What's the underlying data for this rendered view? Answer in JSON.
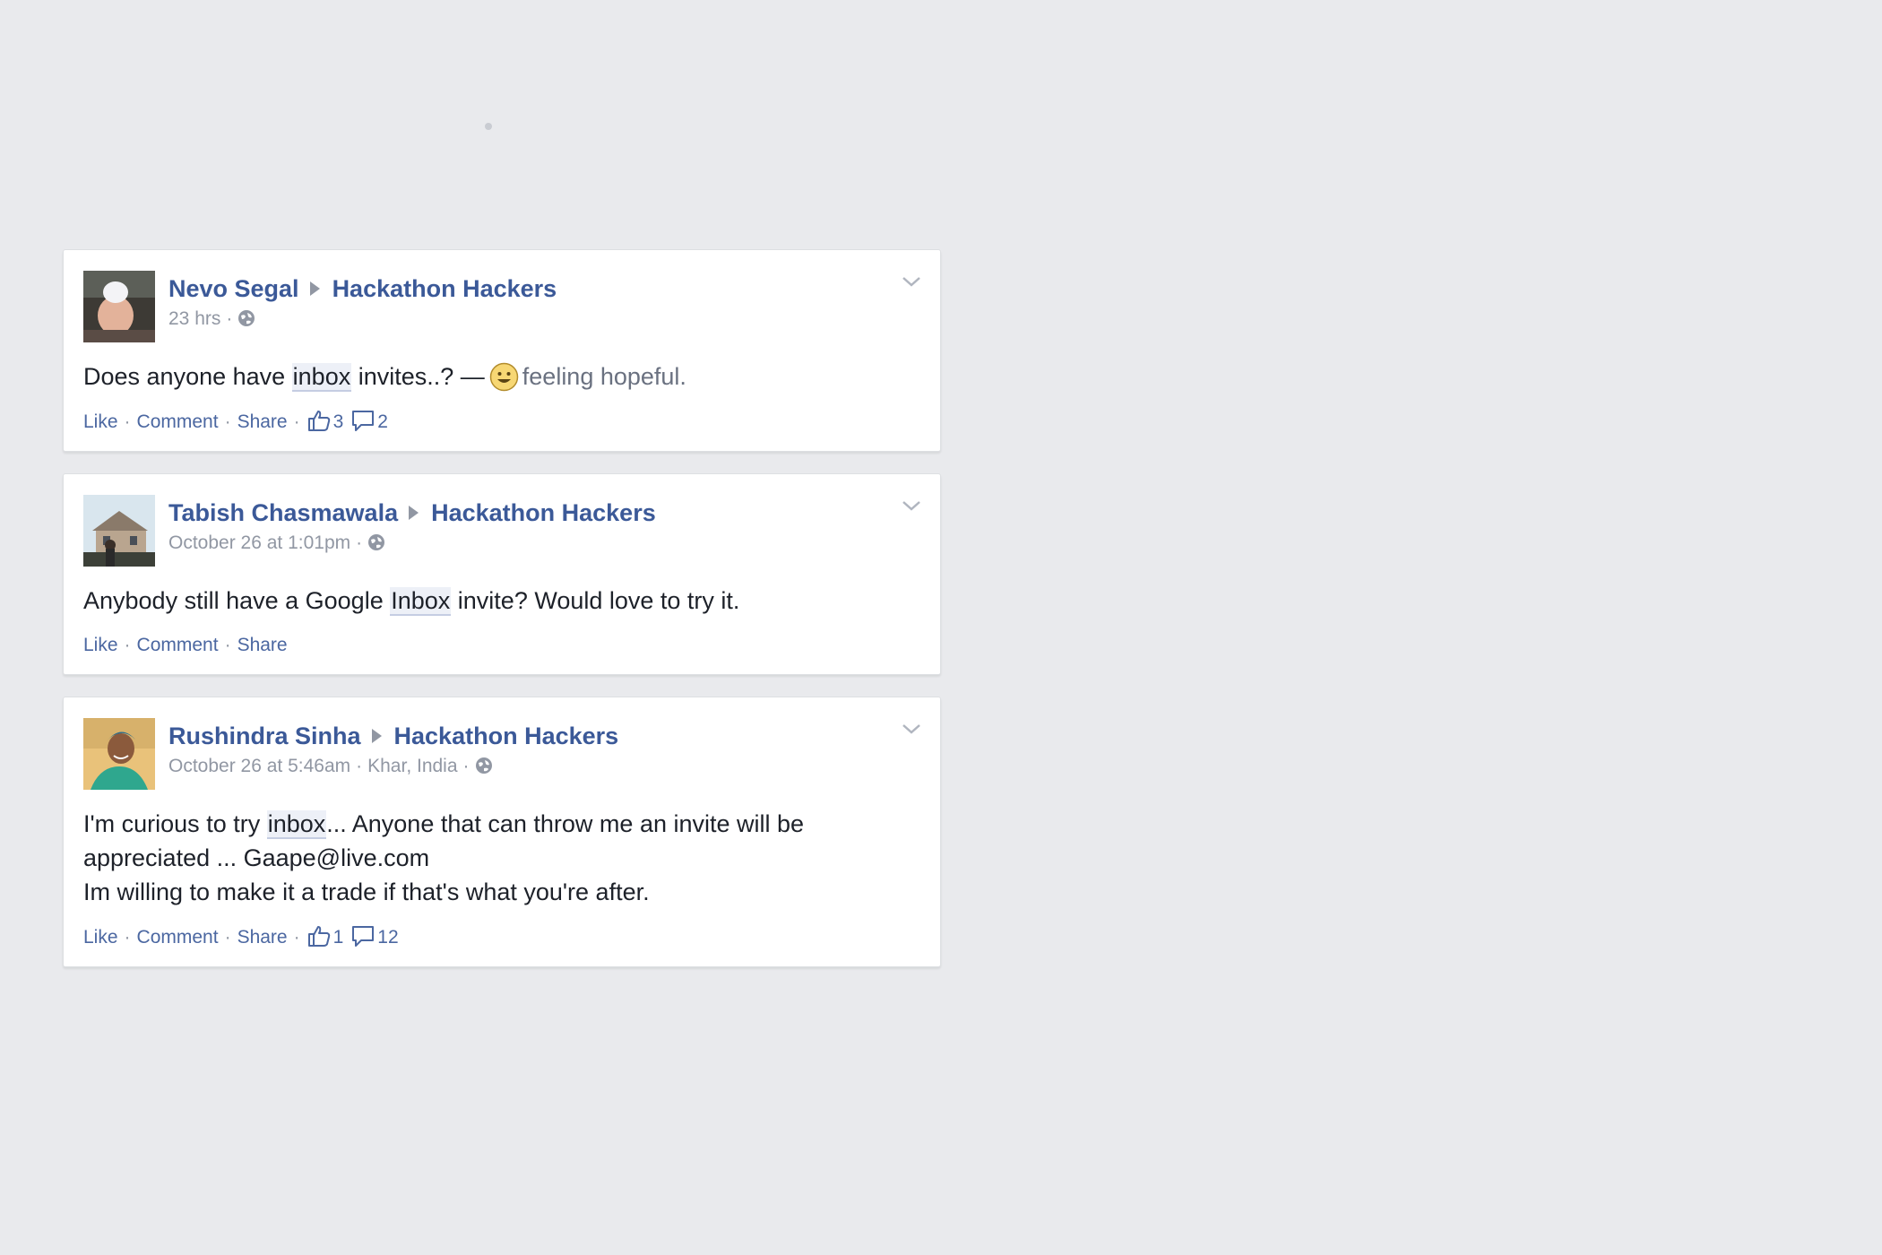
{
  "colors": {
    "background": "#e9eaed",
    "link_blue": "#3b5998",
    "meta_gray": "#9197a3",
    "body_text": "#1d2129"
  },
  "stories": [
    {
      "author": "Nevo Segal",
      "group": "Hackathon Hackers",
      "timestamp": "23 hrs",
      "location": "",
      "body_before": "Does anyone have ",
      "highlight": "inbox",
      "body_after": " invites..? —",
      "feeling": "feeling hopeful.",
      "actions": {
        "like": "Like",
        "comment": "Comment",
        "share": "Share"
      },
      "likes": "3",
      "comments": "2"
    },
    {
      "author": "Tabish Chasmawala",
      "group": "Hackathon Hackers",
      "timestamp": "October 26 at 1:01pm",
      "location": "",
      "body_before": "Anybody still have a Google ",
      "highlight": "Inbox",
      "body_after": " invite? Would love to try it.",
      "actions": {
        "like": "Like",
        "comment": "Comment",
        "share": "Share"
      }
    },
    {
      "author": "Rushindra Sinha",
      "group": "Hackathon Hackers",
      "timestamp": "October 26 at 5:46am",
      "location": "Khar, India",
      "body_before": "I'm curious to try ",
      "highlight": "inbox",
      "body_after": "... Anyone that can throw me an invite will be appreciated ... Gaape@live.com",
      "body_line2": "Im willing to make it a trade if that's what you're after.",
      "actions": {
        "like": "Like",
        "comment": "Comment",
        "share": "Share"
      },
      "likes": "1",
      "comments": "12"
    }
  ]
}
